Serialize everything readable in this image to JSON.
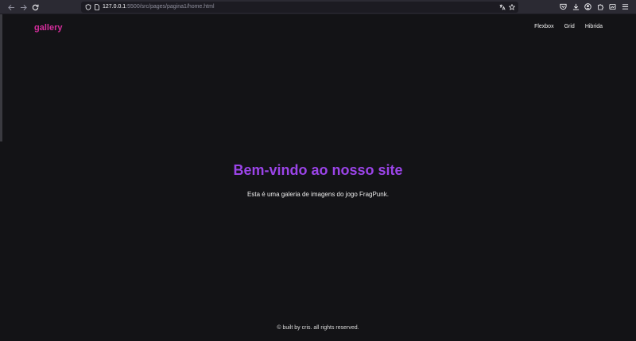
{
  "browser": {
    "url_host": "127.0.0.1",
    "url_path": ":5500/src/pages/pagina1/home.html",
    "icons": {
      "back": "back-arrow-icon",
      "forward": "forward-arrow-icon",
      "reload": "reload-icon",
      "site_info": "shield-icon",
      "page_info": "page-icon",
      "translate": "translate-icon",
      "bookmark": "star-icon",
      "pocket": "pocket-icon",
      "downloads": "download-icon",
      "account": "account-icon",
      "extensions": "puzzle-icon",
      "screenshot": "screenshot-icon",
      "menu": "hamburger-menu-icon"
    }
  },
  "site": {
    "logo": "gallery",
    "nav": [
      "Flexbox",
      "Grid",
      "Hibrida"
    ],
    "hero": {
      "title": "Bem-vindo ao nosso site",
      "text": "Esta é uma galeria de imagens do jogo FragPunk."
    },
    "footer": "© built by cris. all rights reserved."
  },
  "colors": {
    "page_background": "#131316",
    "logo": "#d42d9c",
    "hero_title": "#9b44e8",
    "browser_toolbar": "#2b2a33",
    "urlbar": "#1c1b22"
  }
}
